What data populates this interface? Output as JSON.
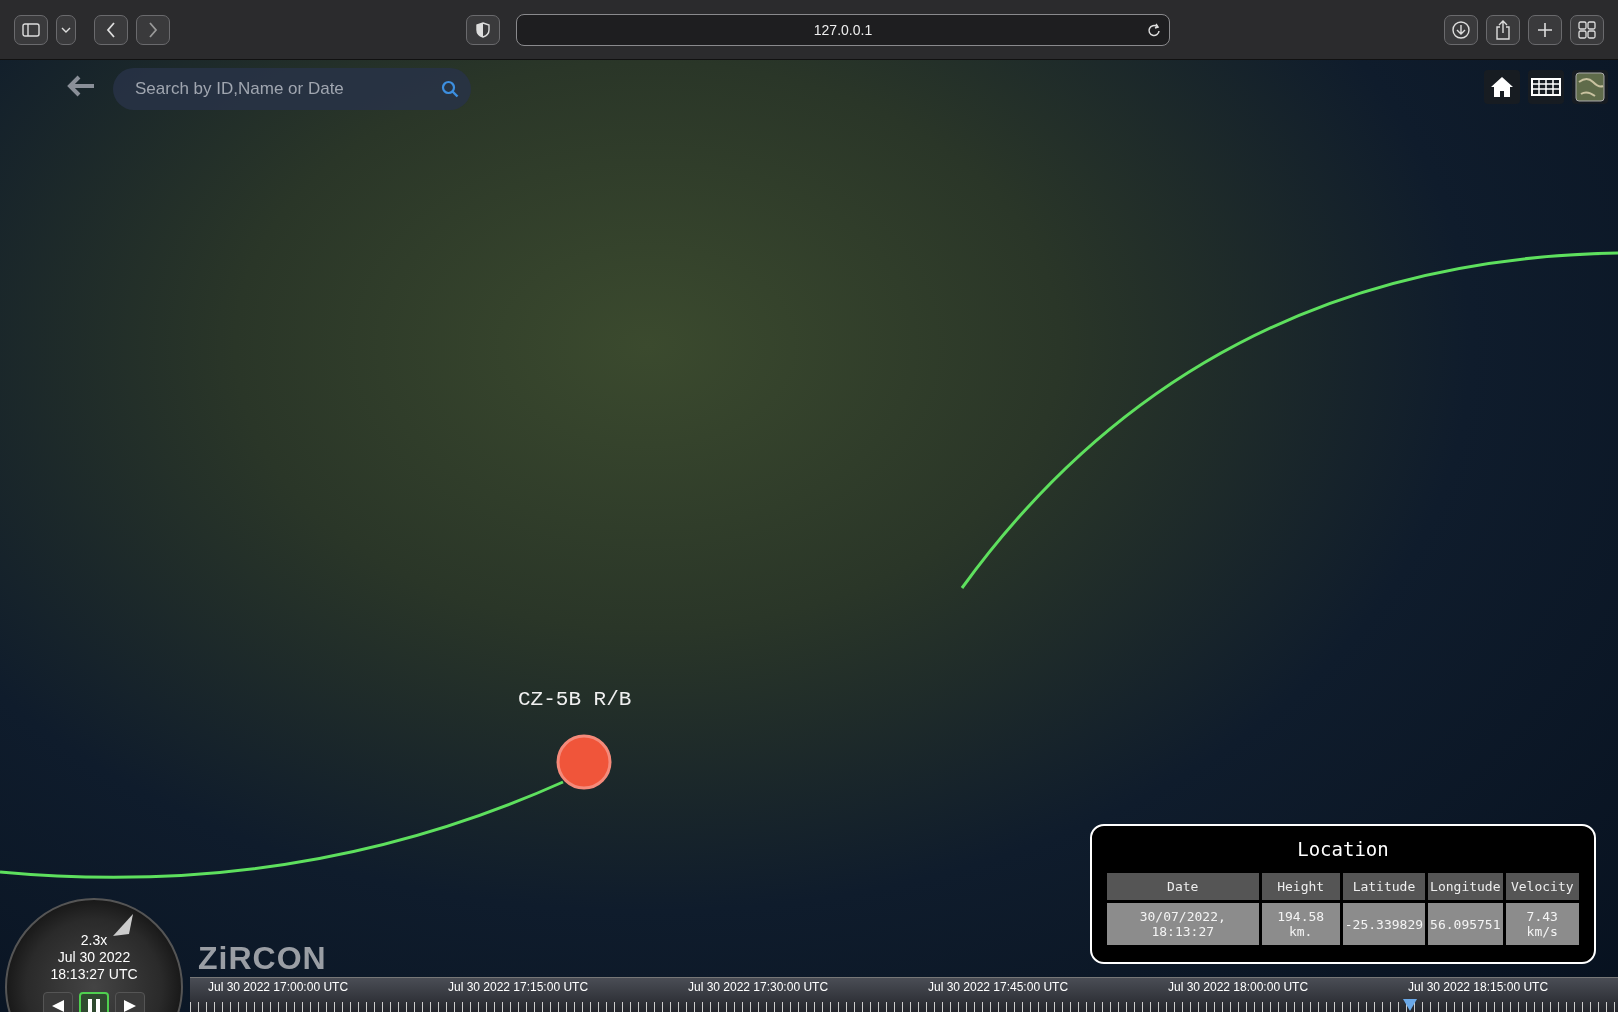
{
  "browser": {
    "address": "127.0.0.1"
  },
  "search": {
    "placeholder": "Search by ID,Name or Date"
  },
  "satellite": {
    "label": "CZ-5B R/B"
  },
  "location": {
    "title": "Location",
    "columns": [
      "Date",
      "Height",
      "Latitude",
      "Longitude",
      "Velocity"
    ],
    "row": [
      "30/07/2022, 18:13:27",
      "194.58 km.",
      "-25.339829",
      "56.095751",
      "7.43 km/s"
    ]
  },
  "clock": {
    "speed": "2.3x",
    "date": "Jul 30 2022",
    "time": "18:13:27 UTC",
    "playing": true
  },
  "logo": "ZiRCON",
  "timeline": {
    "labels": [
      "Jul 30 2022 17:00:00 UTC",
      "Jul 30 2022 17:15:00 UTC",
      "Jul 30 2022 17:30:00 UTC",
      "Jul 30 2022 17:45:00 UTC",
      "Jul 30 2022 18:00:00 UTC",
      "Jul 30 2022 18:15:00 UTC"
    ],
    "level": 0.854
  }
}
